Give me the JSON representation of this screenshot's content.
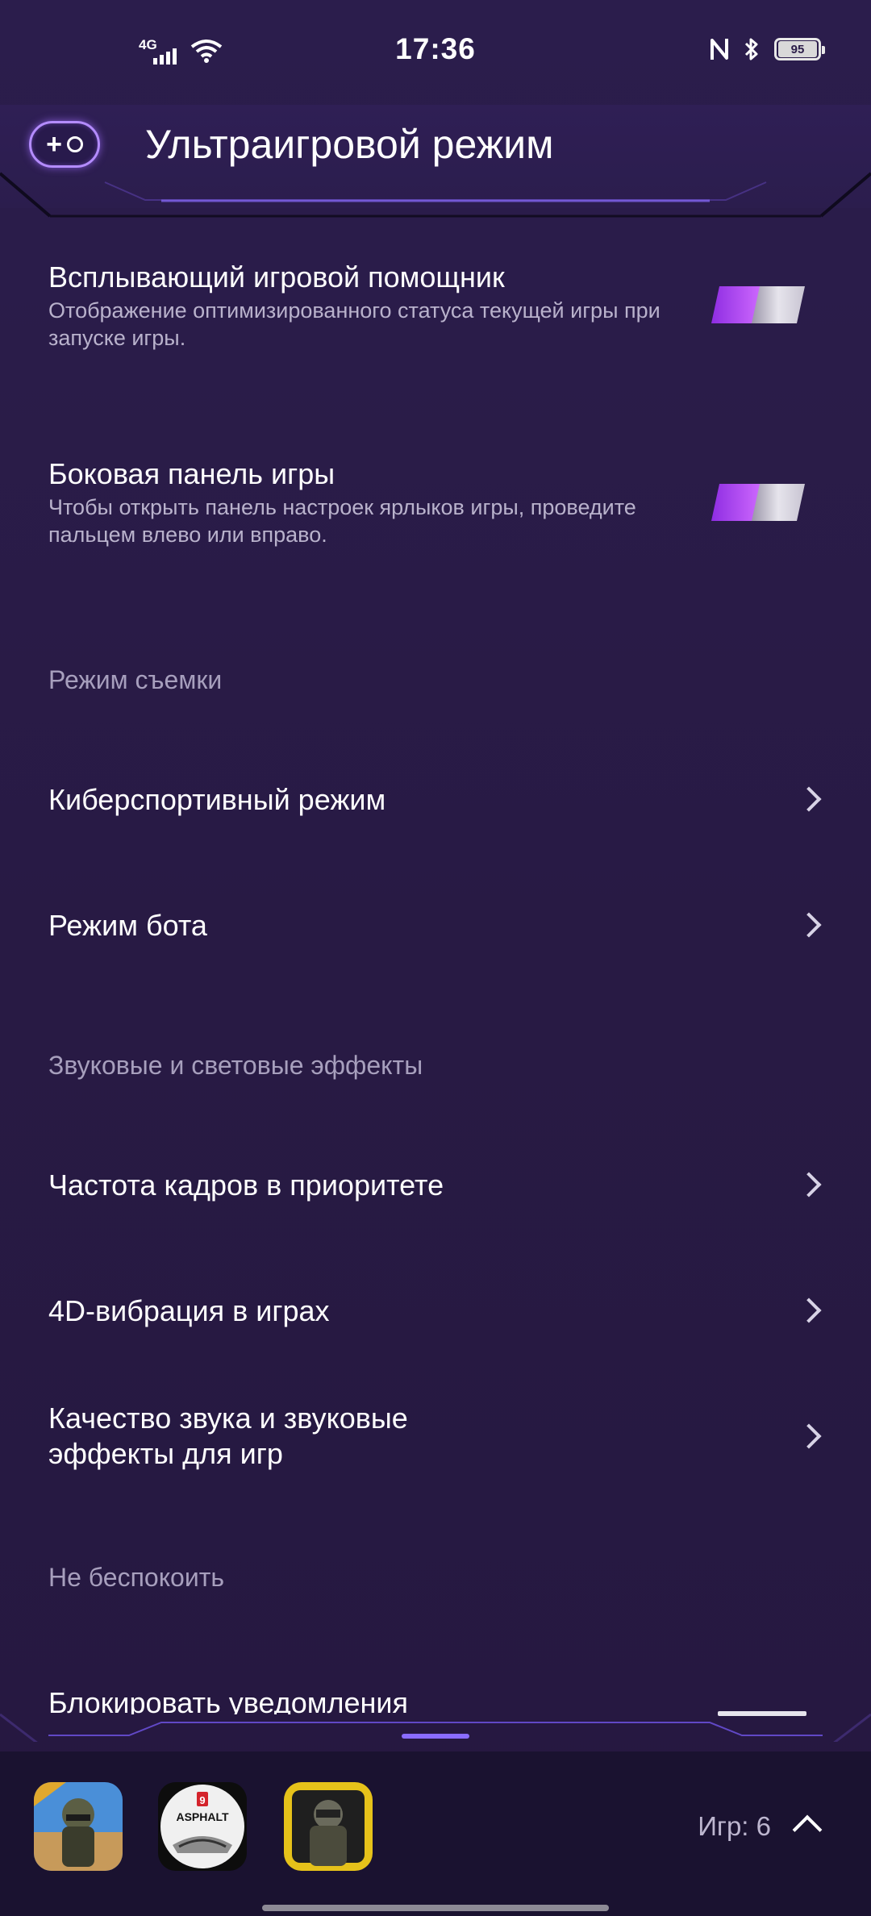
{
  "status_bar": {
    "network": "4G",
    "time": "17:36",
    "battery": "95"
  },
  "header": {
    "title": "Ультраигровой режим"
  },
  "settings": {
    "game_assistant": {
      "title": "Всплывающий игровой помощник",
      "description": "Отображение оптимизированного статуса текущей игры при запуске игры.",
      "enabled": true
    },
    "game_sidebar": {
      "title": "Боковая панель игры",
      "description": "Чтобы открыть панель настроек ярлыков игры, проведите пальцем влево или вправо.",
      "enabled": true
    },
    "section_capture": "Режим съемки",
    "esports_mode": "Киберспортивный режим",
    "bot_mode": "Режим бота",
    "section_effects": "Звуковые и световые эффекты",
    "frame_rate_priority": "Частота кадров в приоритете",
    "vibration_4d": "4D-вибрация в играх",
    "sound_quality": "Качество звука и звуковые эффекты для игр",
    "section_dnd": "Не беспокоить",
    "block_notifications": "Блокировать уведомления"
  },
  "dock": {
    "games": [
      {
        "name": "pubg-game-icon"
      },
      {
        "name": "asphalt-game-icon"
      },
      {
        "name": "call-of-duty-game-icon"
      }
    ],
    "count_label": "Игр: 6"
  },
  "colors": {
    "background": "#2a1c48",
    "accent": "#a855f7",
    "text_secondary": "#b9b2cc"
  }
}
